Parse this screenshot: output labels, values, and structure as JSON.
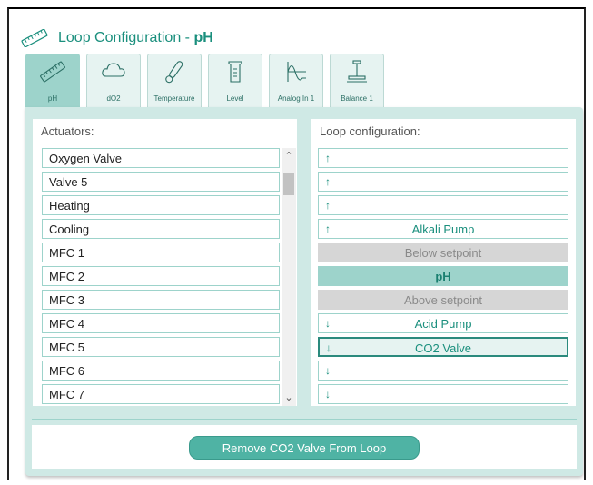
{
  "header": {
    "title_prefix": "Loop Configuration - ",
    "title_loop": "pH"
  },
  "tabs": [
    {
      "label": "pH",
      "icon": "ph-probe-icon",
      "active": true
    },
    {
      "label": "dO2",
      "icon": "cloud-icon",
      "active": false
    },
    {
      "label": "Temperature",
      "icon": "thermometer-icon",
      "active": false
    },
    {
      "label": "Level",
      "icon": "beaker-icon",
      "active": false
    },
    {
      "label": "Analog In 1",
      "icon": "waveform-icon",
      "active": false
    },
    {
      "label": "Balance 1",
      "icon": "balance-icon",
      "active": false
    }
  ],
  "actuators": {
    "heading": "Actuators:",
    "items": [
      "Oxygen Valve",
      "Valve 5",
      "Heating",
      "Cooling",
      "MFC 1",
      "MFC 2",
      "MFC 3",
      "MFC 4",
      "MFC 5",
      "MFC 6",
      "MFC 7"
    ]
  },
  "loop": {
    "heading": "Loop configuration:",
    "slots": [
      {
        "arrow": "↑",
        "name": ""
      },
      {
        "arrow": "↑",
        "name": ""
      },
      {
        "arrow": "↑",
        "name": ""
      },
      {
        "arrow": "↑",
        "name": "Alkali Pump"
      },
      {
        "arrow": "",
        "name": "Below setpoint"
      },
      {
        "arrow": "",
        "name": "pH"
      },
      {
        "arrow": "",
        "name": "Above setpoint"
      },
      {
        "arrow": "↓",
        "name": "Acid Pump"
      },
      {
        "arrow": "↓",
        "name": "CO2 Valve"
      },
      {
        "arrow": "↓",
        "name": ""
      },
      {
        "arrow": "↓",
        "name": ""
      }
    ]
  },
  "actions": {
    "remove_label": "Remove CO2 Valve From Loop"
  },
  "colors": {
    "accent": "#1a8f7d",
    "tab_active": "#9dd3cb",
    "panel_bg": "#cfe9e5",
    "button": "#4fb3a4"
  }
}
